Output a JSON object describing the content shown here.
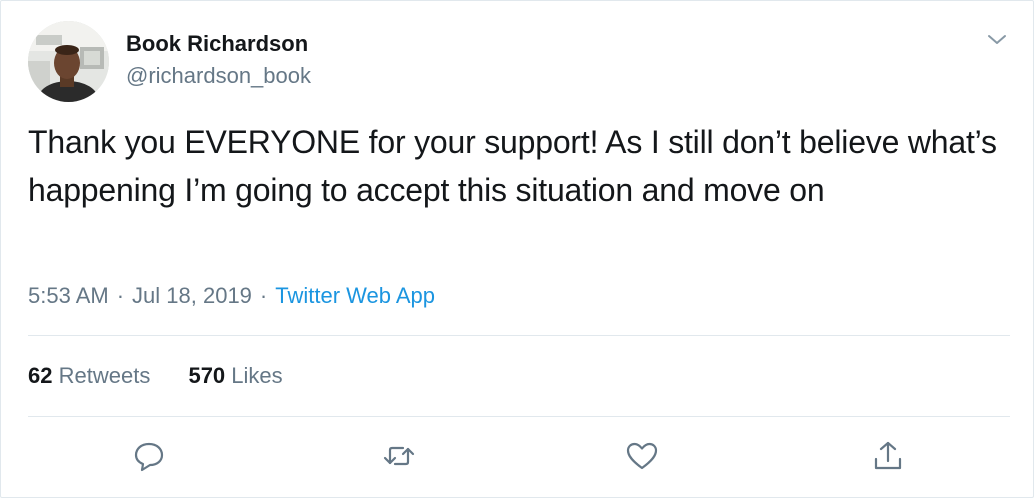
{
  "author": {
    "display_name": "Book Richardson",
    "handle": "@richardson_book"
  },
  "tweet": {
    "text": "Thank you EVERYONE for your support! As I still don’t believe what’s happening I’m going to accept this situation and move on",
    "time": "5:53 AM",
    "separator": "·",
    "date": "Jul 18, 2019",
    "source": "Twitter Web App"
  },
  "stats": {
    "retweets_count": "62",
    "retweets_label": "Retweets",
    "likes_count": "570",
    "likes_label": "Likes"
  },
  "icons": {
    "menu": "chevron-down-icon",
    "reply": "reply-icon",
    "retweet": "retweet-icon",
    "like": "heart-icon",
    "share": "share-icon"
  },
  "colors": {
    "text_primary": "#14171a",
    "text_secondary": "#657786",
    "link": "#1b95e0",
    "border": "#e1e8ed"
  }
}
